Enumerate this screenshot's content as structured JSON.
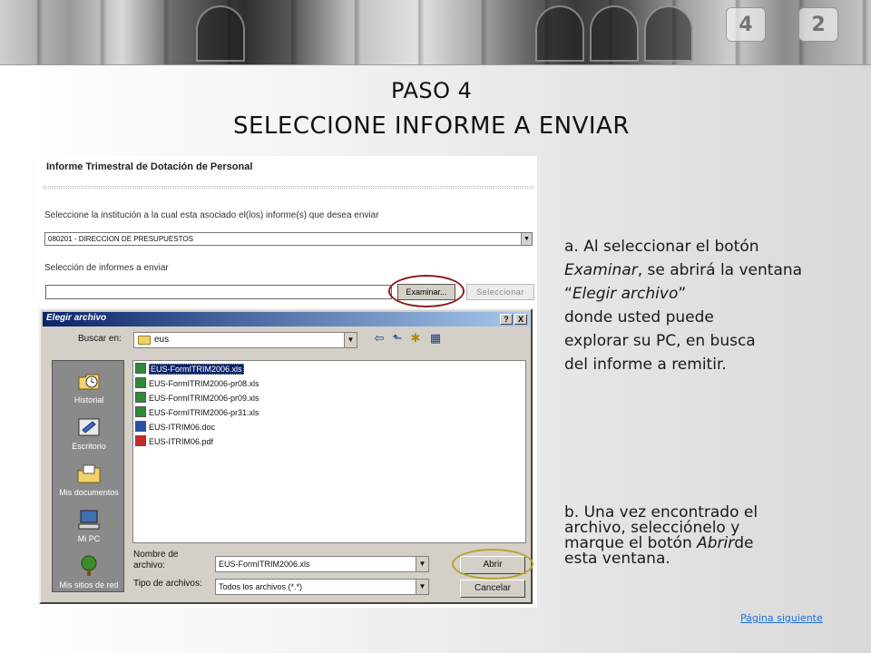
{
  "slide": {
    "title_line1": "PASO 4",
    "title_line2": "SELECCIONE INFORME A ENVIAR",
    "next_link": "Página siguiente"
  },
  "form": {
    "heading": "Informe Trimestral de Dotación de Personal",
    "institution_label": "Seleccione la institución a la cual esta asociado el(los) informe(s) que desea enviar",
    "institution_value": "080201 - DIRECCION DE PRESUPUESTOS",
    "selection_label": "Selección de informes a enviar",
    "examinar_button": "Examinar...",
    "seleccionar_button": "Seleccionar"
  },
  "dialog": {
    "title": "Elegir archivo",
    "help_glyph": "?",
    "close_glyph": "X",
    "look_in_label": "Buscar en:",
    "look_in_value": "eus",
    "places": [
      {
        "label": "Historial",
        "icon": "history-icon"
      },
      {
        "label": "Escritorio",
        "icon": "desktop-icon"
      },
      {
        "label": "Mis documentos",
        "icon": "my-documents-icon"
      },
      {
        "label": "Mi PC",
        "icon": "my-computer-icon"
      },
      {
        "label": "Mis sitios de red",
        "icon": "network-places-icon"
      }
    ],
    "files": [
      {
        "name": "EUS-FormITRIM2006.xls",
        "type": "xls",
        "selected": true
      },
      {
        "name": "EUS-FormITRIM2006-pr08.xls",
        "type": "xls",
        "selected": false
      },
      {
        "name": "EUS-FormITRIM2006-pr09.xls",
        "type": "xls",
        "selected": false
      },
      {
        "name": "EUS-FormITRIM2006-pr31.xls",
        "type": "xls",
        "selected": false
      },
      {
        "name": "EUS-ITRIM06.doc",
        "type": "doc",
        "selected": false
      },
      {
        "name": "EUS-ITRIM06.pdf",
        "type": "pdf",
        "selected": false
      }
    ],
    "filename_label": "Nombre de archivo:",
    "filename_value": "EUS-FormITRIM2006.xls",
    "filetype_label": "Tipo de archivos:",
    "filetype_value": "Todos los archivos (*.*)",
    "open_button": "Abrir",
    "cancel_button": "Cancelar"
  },
  "instructions": {
    "a_prefix": "a. Al seleccionar el botón",
    "a_examinar": "Examinar",
    "a_mid": ", se abrirá la ventana “",
    "a_elegir": "Elegir archivo",
    "a_rest1": "”",
    "a_line4": "donde usted puede",
    "a_line5": "explorar su PC, en busca",
    "a_line6": "del informe a remitir.",
    "b_line1": "b. Una vez encontrado el",
    "b_line2": "archivo, selecciónelo y",
    "b_line3_pre": "marque el botón ",
    "b_abrir": "Abrir",
    "b_line3_post": "de",
    "b_line4": "esta ventana."
  },
  "colors": {
    "highlight_oval_examinar": "#8b1a1a",
    "highlight_oval_abrir": "#b5a42a",
    "link": "#1d6fd6",
    "dialog_title_bar": "#0a246a"
  }
}
